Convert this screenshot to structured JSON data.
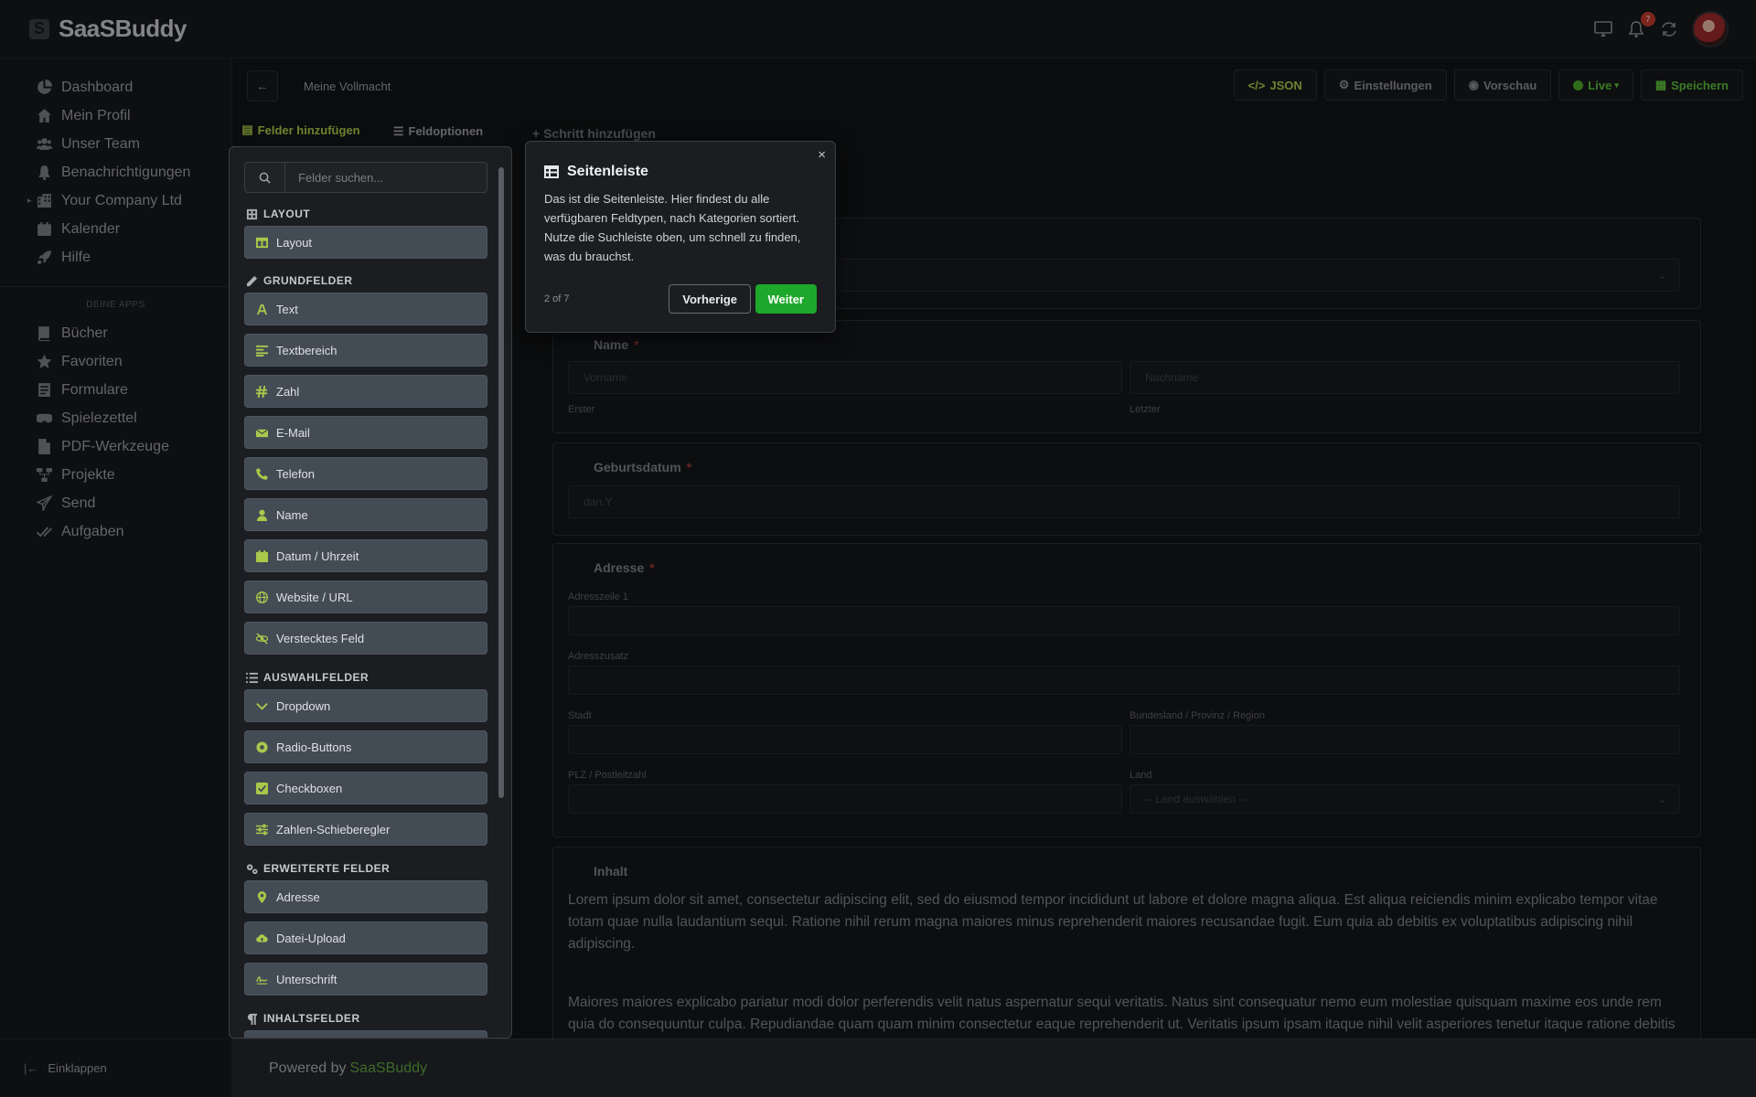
{
  "app": {
    "name": "SaaSBuddy",
    "logo_letter": "S"
  },
  "topbar": {
    "notification_count": "7"
  },
  "sidebar": {
    "items": [
      {
        "label": "Dashboard",
        "icon": "pie-chart-icon"
      },
      {
        "label": "Mein Profil",
        "icon": "home-icon"
      },
      {
        "label": "Unser Team",
        "icon": "users-icon"
      },
      {
        "label": "Benachrichtigungen",
        "icon": "bell-icon"
      },
      {
        "label": "Your Company Ltd",
        "icon": "building-icon"
      },
      {
        "label": "Kalender",
        "icon": "calendar-icon"
      },
      {
        "label": "Hilfe",
        "icon": "rocket-icon"
      }
    ],
    "apps_heading": "DEINE APPS",
    "apps": [
      {
        "label": "Bücher",
        "icon": "book-icon"
      },
      {
        "label": "Favoriten",
        "icon": "star-icon"
      },
      {
        "label": "Formulare",
        "icon": "form-icon"
      },
      {
        "label": "Spielezettel",
        "icon": "gamepad-icon"
      },
      {
        "label": "PDF-Werkzeuge",
        "icon": "pdf-icon"
      },
      {
        "label": "Projekte",
        "icon": "project-icon"
      },
      {
        "label": "Send",
        "icon": "send-icon"
      },
      {
        "label": "Aufgaben",
        "icon": "check-icon"
      }
    ],
    "collapse_label": "Einklappen"
  },
  "footer": {
    "prefix": "Powered by",
    "brand": "SaaSBuddy"
  },
  "toolbar": {
    "title": "Meine Vollmacht",
    "json": "JSON",
    "settings": "Einstellungen",
    "preview": "Vorschau",
    "live": "Live",
    "save": "Speichern"
  },
  "panel": {
    "tab_add": "Felder hinzufügen",
    "tab_options": "Feldoptionen",
    "search_placeholder": "Felder suchen...",
    "cat_layout": "LAYOUT",
    "cat_basic": "GRUNDFELDER",
    "cat_choice": "AUSWAHLFELDER",
    "cat_advanced": "ERWEITERTE FELDER",
    "cat_content": "INHALTSFELDER",
    "layout": "Layout",
    "text": "Text",
    "textarea": "Textbereich",
    "number": "Zahl",
    "email": "E-Mail",
    "phone": "Telefon",
    "name": "Name",
    "datetime": "Datum / Uhrzeit",
    "url": "Website / URL",
    "hidden": "Verstecktes Feld",
    "dropdown": "Dropdown",
    "radio": "Radio-Buttons",
    "checkbox": "Checkboxen",
    "slider": "Zahlen-Schieberegler",
    "address": "Adresse",
    "upload": "Datei-Upload",
    "signature": "Unterschrift"
  },
  "add_step": "Schritt hinzufügen",
  "form": {
    "name_label": "Name",
    "first_placeholder": "Vorname",
    "last_placeholder": "Nachname",
    "first_sub": "Erster",
    "last_sub": "Letzter",
    "dob_label": "Geburtsdatum",
    "dob_placeholder": "dan.Y",
    "address_label": "Adresse",
    "addr1": "Adresszeile 1",
    "addr2": "Adresszusatz",
    "city": "Stadt",
    "state": "Bundesland / Provinz / Region",
    "zip": "PLZ / Postleitzahl",
    "country": "Land",
    "country_placeholder": "-- Land auswählen --",
    "content_label": "Inhalt",
    "para1": "Lorem ipsum dolor sit amet, consectetur adipiscing elit, sed do eiusmod tempor incididunt ut labore et dolore magna aliqua. Est aliqua reiciendis minim explicabo tempor vitae totam quae nulla laudantium sequi. Ratione nihil rerum magna maiores minus reprehenderit maiores recusandae fugit. Eum quia ab debitis ex voluptatibus adipiscing nihil adipiscing.",
    "para2": "Maiores maiores explicabo pariatur modi dolor perferendis velit natus aspernatur sequi veritatis. Natus sint consequatur nemo eum molestiae quisquam maxime eos unde rem quia do consequuntur culpa. Repudiandae quam quam minim consectetur eaque reprehenderit ut. Veritatis ipsum ipsam itaque nihil velit asperiores tenetur itaque ratione debitis eos sapiente rem temporibus eiusmod. Aperiam velit consectetur nisi facere nesciunt ut rerum eaque reprehenderit laboris ut aliquip rerum. Aspernatur"
  },
  "tour": {
    "title": "Seitenleiste",
    "text": "Das ist die Seitenleiste. Hier findest du alle verfügbaren Feldtypen, nach Kategorien sortiert. Nutze die Suchleiste oben, um schnell zu finden, was du brauchst.",
    "step": "2 of 7",
    "prev": "Vorherige",
    "next": "Weiter",
    "close": "×"
  },
  "colors": {
    "accent": "#a8c94a",
    "primary_button": "#1ea82b",
    "background": "#111315"
  }
}
